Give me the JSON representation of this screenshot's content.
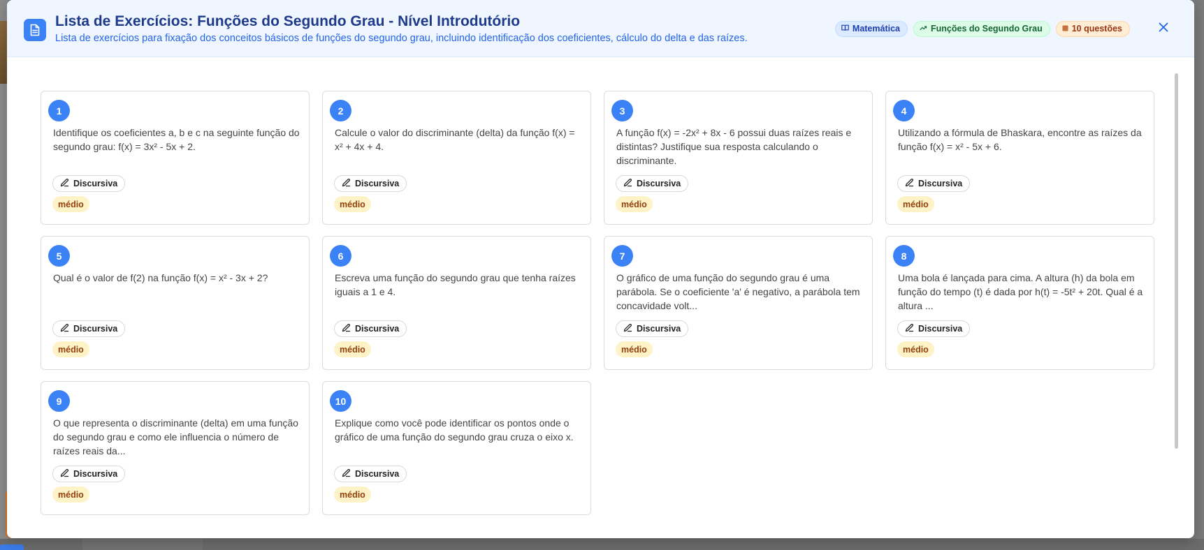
{
  "header": {
    "title": "Lista de Exercícios: Funções do Segundo Grau - Nível Introdutório",
    "subtitle": "Lista de exercícios para fixação dos conceitos básicos de funções do segundo grau, incluindo identificação dos coeficientes, cálculo do delta e das raízes.",
    "icon": "document-icon",
    "badges": {
      "subject": {
        "label": "Matemática",
        "icon": "book-icon",
        "color": "#1e40af"
      },
      "topic": {
        "label": "Funções do Segundo Grau",
        "icon": "trend-icon",
        "color": "#166534"
      },
      "count": {
        "label": "10 questões",
        "icon": "square-icon",
        "color": "#9a3412"
      }
    },
    "close_icon": "close-icon"
  },
  "questions": [
    {
      "number": "1",
      "text": "Identifique os coeficientes a, b e c na seguinte função do segundo grau: f(x) = 3x² - 5x + 2.",
      "type": "Discursiva",
      "difficulty": "médio"
    },
    {
      "number": "2",
      "text": "Calcule o valor do discriminante (delta) da função f(x) = x² + 4x + 4.",
      "type": "Discursiva",
      "difficulty": "médio"
    },
    {
      "number": "3",
      "text": "A função f(x) = -2x² + 8x - 6 possui duas raízes reais e distintas? Justifique sua resposta calculando o discriminante.",
      "type": "Discursiva",
      "difficulty": "médio"
    },
    {
      "number": "4",
      "text": "Utilizando a fórmula de Bhaskara, encontre as raízes da função f(x) = x² - 5x + 6.",
      "type": "Discursiva",
      "difficulty": "médio"
    },
    {
      "number": "5",
      "text": "Qual é o valor de f(2) na função f(x) = x² - 3x + 2?",
      "type": "Discursiva",
      "difficulty": "médio"
    },
    {
      "number": "6",
      "text": "Escreva uma função do segundo grau que tenha raízes iguais a 1 e 4.",
      "type": "Discursiva",
      "difficulty": "médio"
    },
    {
      "number": "7",
      "text": "O gráfico de uma função do segundo grau é uma parábola. Se o coeficiente 'a' é negativo, a parábola tem concavidade volt...",
      "type": "Discursiva",
      "difficulty": "médio"
    },
    {
      "number": "8",
      "text": "Uma bola é lançada para cima. A altura (h) da bola em função do tempo (t) é dada por h(t) = -5t² + 20t. Qual é a altura ...",
      "type": "Discursiva",
      "difficulty": "médio"
    },
    {
      "number": "9",
      "text": "O que representa o discriminante (delta) em uma função do segundo grau e como ele influencia o número de raízes reais da...",
      "type": "Discursiva",
      "difficulty": "médio"
    },
    {
      "number": "10",
      "text": "Explique como você pode identificar os pontos onde o gráfico de uma função do segundo grau cruza o eixo x.",
      "type": "Discursiva",
      "difficulty": "médio"
    }
  ],
  "colors": {
    "accent": "#3b82f6",
    "title": "#1e3a8a",
    "difficulty_bg": "#fef3c7",
    "difficulty_text": "#92400e"
  }
}
